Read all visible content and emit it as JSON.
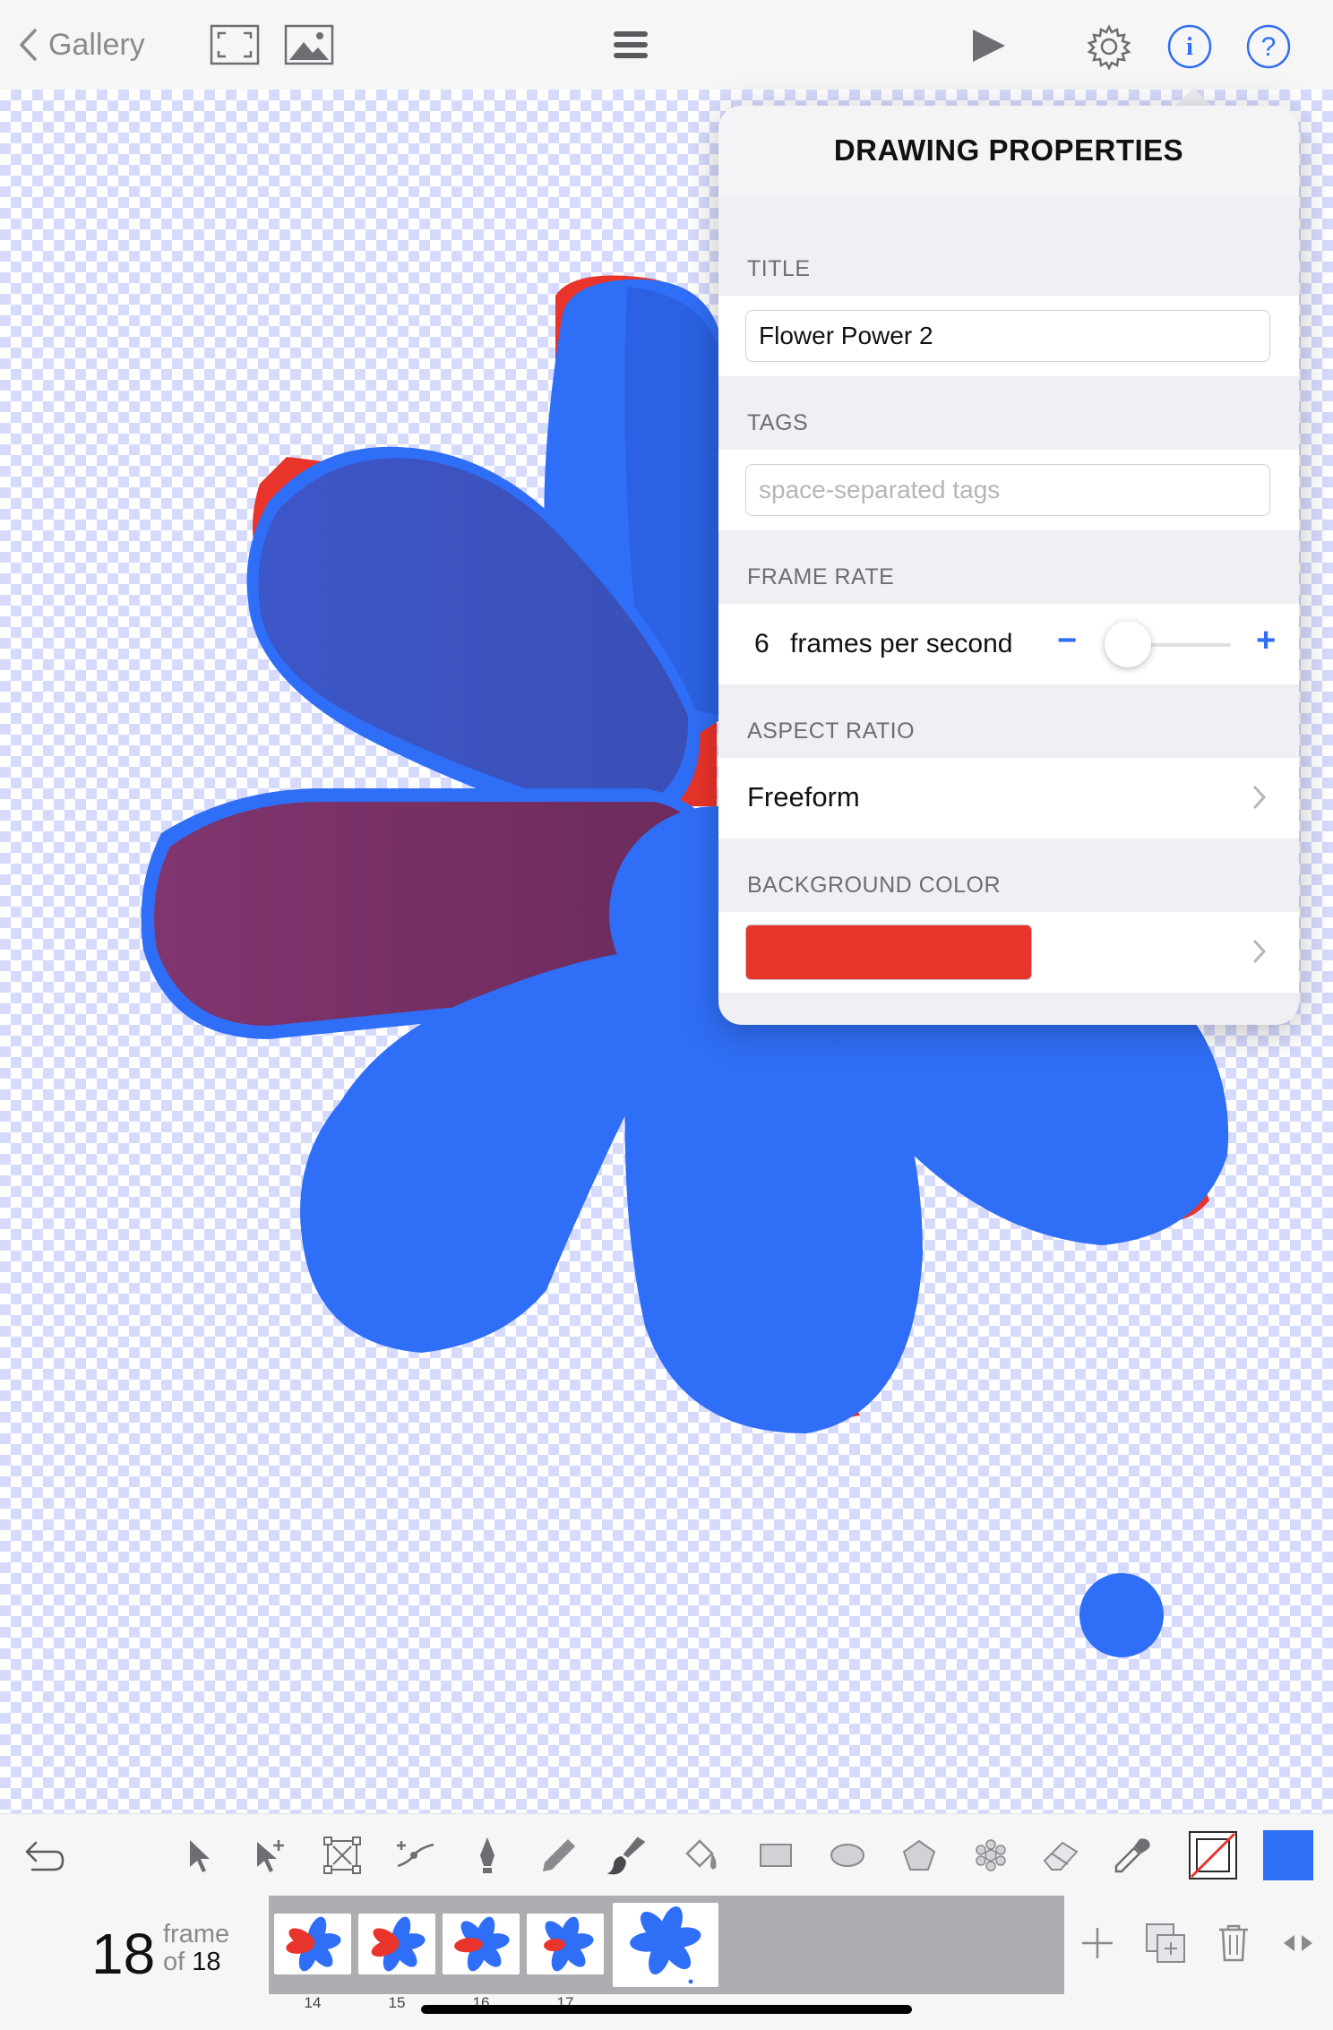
{
  "topbar": {
    "back_label": "Gallery",
    "icons": [
      "chevron-left-icon",
      "fullscreen-icon",
      "image-icon",
      "menu-icon",
      "play-icon",
      "gear-icon",
      "info-icon",
      "help-icon"
    ]
  },
  "popover": {
    "title": "DRAWING PROPERTIES",
    "title_section": "TITLE",
    "title_value": "Flower Power 2",
    "tags_section": "TAGS",
    "tags_placeholder": "space-separated tags",
    "tags_value": "",
    "frame_rate_section": "FRAME RATE",
    "fps_value": "6",
    "fps_label": "frames per second",
    "fps_minus": "−",
    "fps_plus": "+",
    "fps_slider_fraction": 0.18,
    "aspect_section": "ASPECT RATIO",
    "aspect_value": "Freeform",
    "bg_section": "BACKGROUND COLOR",
    "bg_color": "#e8342a"
  },
  "toolbar": {
    "tools": [
      "undo-icon",
      "select-icon",
      "add-select-icon",
      "transform-icon",
      "path-edit-icon",
      "pen-icon",
      "pencil-icon",
      "brush-icon",
      "fill-icon",
      "rectangle-icon",
      "ellipse-icon",
      "polygon-icon",
      "star-shape-icon",
      "eraser-icon",
      "eyedropper-icon",
      "stroke-color-well",
      "fill-color-well"
    ],
    "fill_color": "#2f6ef6"
  },
  "frames": {
    "current": "18",
    "word": "frame",
    "of_word": "of",
    "total": "18",
    "thumbnails": [
      {
        "num": "14"
      },
      {
        "num": "15"
      },
      {
        "num": "16"
      },
      {
        "num": "17"
      },
      {
        "num": ""
      }
    ]
  },
  "colors": {
    "accent": "#2f6ef6",
    "petal_blue": "#2f6ef6",
    "petal_red": "#e8342a",
    "petal_purple": "#7f336b"
  }
}
